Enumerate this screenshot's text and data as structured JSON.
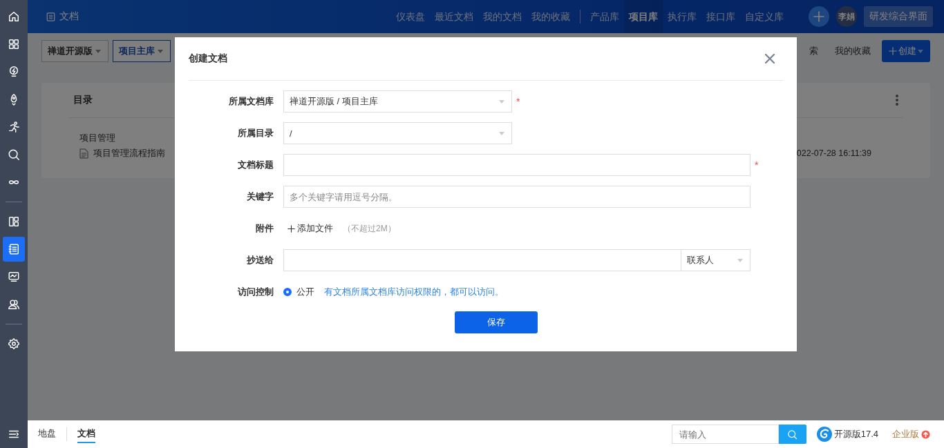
{
  "sidebar": {
    "groups": [
      {
        "items": [
          {
            "selected": false
          },
          {
            "selected": false
          },
          {
            "selected": false
          },
          {
            "selected": false
          },
          {
            "selected": false
          },
          {
            "selected": false
          },
          {
            "selected": false
          }
        ]
      },
      {
        "items": [
          {
            "selected": false
          },
          {
            "selected": true
          },
          {
            "selected": false
          },
          {
            "selected": false
          }
        ]
      },
      {
        "items": [
          {
            "selected": false
          }
        ]
      }
    ]
  },
  "header": {
    "title": "文档",
    "nav_groups": [
      [
        {
          "label": "仪表盘",
          "selected": false
        },
        {
          "label": "最近文档",
          "selected": false
        },
        {
          "label": "我的文档",
          "selected": false
        },
        {
          "label": "我的收藏",
          "selected": false
        }
      ],
      [
        {
          "label": "产品库",
          "selected": false
        },
        {
          "label": "项目库",
          "selected": true
        },
        {
          "label": "执行库",
          "selected": false
        },
        {
          "label": "接口库",
          "selected": false
        },
        {
          "label": "自定义库",
          "selected": false
        }
      ]
    ],
    "avatar": "李娟",
    "view_button": "研发综合界面"
  },
  "toolbar": {
    "breadcrumbs": [
      {
        "label": "禅道开源版",
        "selected": false
      },
      {
        "label": "项目主库",
        "selected": true
      }
    ],
    "links": [
      "索",
      "我的收藏"
    ],
    "create_button": "创建"
  },
  "catalog": {
    "title": "目录",
    "group": "项目管理",
    "doc": "项目管理流程指南",
    "date": "022-07-28 16:11:39"
  },
  "dialog": {
    "title": "创建文档",
    "fields": [
      {
        "kind": "select",
        "label": "所属文档库",
        "value": "禅道开源版 / 项目主库",
        "required_mark": "*"
      },
      {
        "kind": "select",
        "label": "所属目录",
        "value": "/"
      },
      {
        "kind": "text",
        "label": "文档标题",
        "required_mark": "*"
      },
      {
        "kind": "text",
        "label": "关键字",
        "placeholder": "多个关键字请用逗号分隔。"
      },
      {
        "kind": "file",
        "label": "附件",
        "action": "添加文件",
        "hint": "（不超过2M）"
      },
      {
        "kind": "users",
        "label": "抄送给",
        "picker": "联系人"
      },
      {
        "kind": "radio",
        "label": "访问控制",
        "option": "公开",
        "checked": true,
        "note": "有文档所属文档库访问权限的，都可以访问。"
      }
    ],
    "submit": "保存"
  },
  "footer": {
    "tabs": [
      {
        "label": "地盘",
        "selected": false
      },
      {
        "label": "文档",
        "selected": true
      }
    ],
    "search_placeholder": "请输入",
    "version": "开源版17.4",
    "upgrade": "企业版"
  }
}
